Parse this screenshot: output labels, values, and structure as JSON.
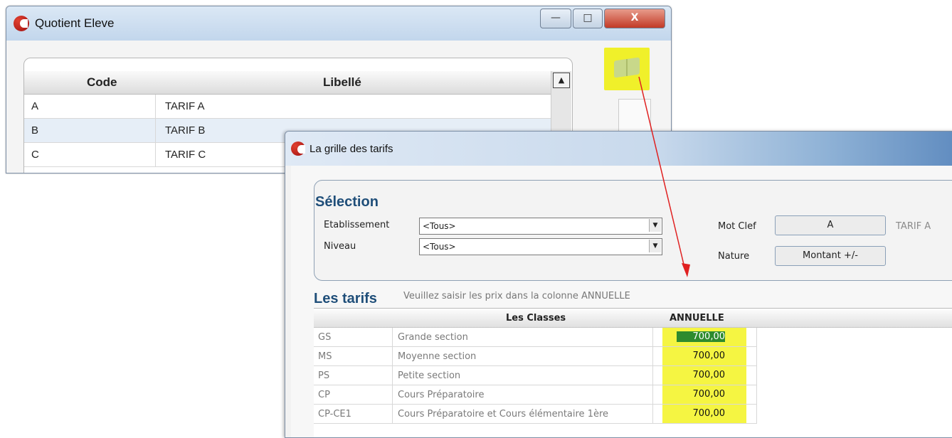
{
  "window1": {
    "title": "Quotient Eleve",
    "grid": {
      "columns": [
        "Code",
        "Libellé"
      ],
      "rows": [
        {
          "code": "A",
          "libelle": "TARIF A"
        },
        {
          "code": "B",
          "libelle": "TARIF B"
        },
        {
          "code": "C",
          "libelle": "TARIF C"
        }
      ]
    },
    "caption_buttons": {
      "minimize": "—",
      "maximize": "□",
      "close": "X"
    }
  },
  "window2": {
    "title": "La grille des tarifs",
    "selection": {
      "title": "Sélection",
      "etablissement_label": "Etablissement",
      "etablissement_value": "<Tous>",
      "niveau_label": "Niveau",
      "niveau_value": "<Tous>",
      "mot_clef_label": "Mot Clef",
      "mot_clef_value": "A",
      "mot_clef_desc": "TARIF A",
      "nature_label": "Nature",
      "nature_value": "Montant +/-"
    },
    "tarifs": {
      "title": "Les tarifs",
      "hint": "Veuillez saisir les prix dans la colonne ANNUELLE",
      "columns": [
        "Les Classes",
        "ANNUELLE"
      ],
      "rows": [
        {
          "code": "GS",
          "libelle": "Grande section",
          "annuelle": "700,00"
        },
        {
          "code": "MS",
          "libelle": "Moyenne section",
          "annuelle": "700,00"
        },
        {
          "code": "PS",
          "libelle": "Petite section",
          "annuelle": "700,00"
        },
        {
          "code": "CP",
          "libelle": "Cours Préparatoire",
          "annuelle": "700,00"
        },
        {
          "code": "CP-CE1",
          "libelle": "Cours Préparatoire et Cours élémentaire 1ère",
          "annuelle": "700,00"
        }
      ]
    }
  },
  "colors": {
    "highlight_yellow": "#f5f542",
    "selected_cell": "#2e8b2e",
    "section_title": "#1f4e79",
    "arrow": "#e02020"
  }
}
